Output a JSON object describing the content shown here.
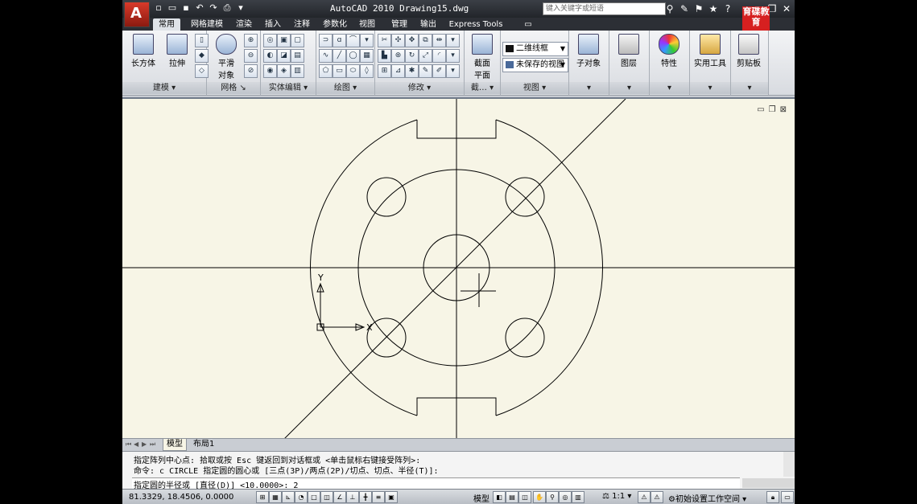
{
  "app": {
    "title": "AutoCAD 2010   Drawing15.dwg",
    "search_placeholder": "键入关键字或短语",
    "brand": "育碟教育",
    "logo_letter": "A"
  },
  "tabs": [
    "常用",
    "网格建模",
    "渲染",
    "插入",
    "注释",
    "参数化",
    "视图",
    "管理",
    "输出",
    "Express Tools"
  ],
  "ribbon": {
    "panels": {
      "modeling": "建模",
      "mesh": "网格",
      "solid_edit": "实体编辑",
      "draw": "绘图",
      "modify": "修改",
      "section": "截…",
      "view": "视图"
    },
    "buttons": {
      "box": "长方体",
      "extrude": "拉伸",
      "smooth_line1": "平滑",
      "smooth_line2": "对象",
      "section_line1": "截面",
      "section_line2": "平面",
      "subobject": "子对象",
      "layers": "图层",
      "properties": "特性",
      "utilities": "实用工具",
      "clipboard": "剪贴板"
    },
    "visual_style": "二维线框",
    "saved_view": "未保存的视图"
  },
  "layout_tabs": [
    "模型",
    "布局1"
  ],
  "command": {
    "line1": "指定阵列中心点: 拾取或按 Esc 键返回到对话框或 <单击鼠标右键接受阵列>:",
    "line2": "命令: c CIRCLE 指定圆的圆心或 [三点(3P)/两点(2P)/切点、切点、半径(T)]:",
    "prompt": "指定圆的半径或 [直径(D)] <10.0000>: 2"
  },
  "status": {
    "coords": "81.3329, 18.4506, 0.0000",
    "model": "模型",
    "scale": "1:1",
    "workspace": "初始设置工作空间"
  },
  "ucs": {
    "x_label": "X",
    "y_label": "Y"
  }
}
